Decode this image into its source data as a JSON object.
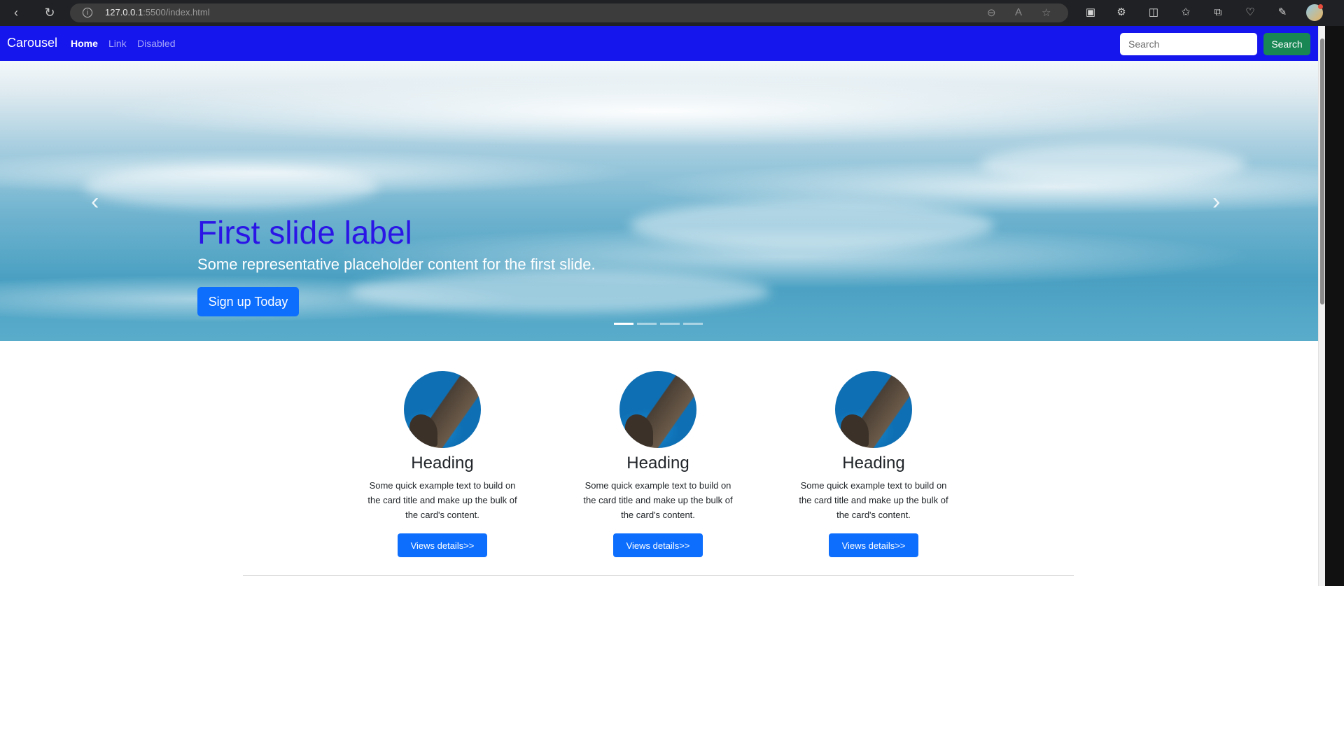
{
  "browser": {
    "url_host": "127.0.0.1",
    "url_path": ":5500/index.html"
  },
  "navbar": {
    "brand": "Carousel",
    "links": [
      {
        "label": "Home",
        "active": true
      },
      {
        "label": "Link",
        "active": false
      },
      {
        "label": "Disabled",
        "active": false
      }
    ],
    "search_placeholder": "Search",
    "search_button": "Search"
  },
  "carousel": {
    "title": "First slide label",
    "text": "Some representative placeholder content for the first slide.",
    "button": "Sign up Today",
    "indicator_count": 4,
    "active_index": 0,
    "prev_icon": "chevron-left-icon",
    "next_icon": "chevron-right-icon"
  },
  "marketing": {
    "columns": [
      {
        "heading": "Heading",
        "text": "Some quick example text to build on the card title and make up the bulk of the card's content.",
        "button": "Views details>>"
      },
      {
        "heading": "Heading",
        "text": "Some quick example text to build on the card title and make up the bulk of the card's content.",
        "button": "Views details>>"
      },
      {
        "heading": "Heading",
        "text": "Some quick example text to build on the card title and make up the bulk of the card's content.",
        "button": "Views details>>"
      }
    ]
  },
  "colors": {
    "navbar_bg": "#1515ee",
    "slide_title": "#2a15e6",
    "primary_button": "#0d6efd",
    "search_button": "#198754"
  }
}
